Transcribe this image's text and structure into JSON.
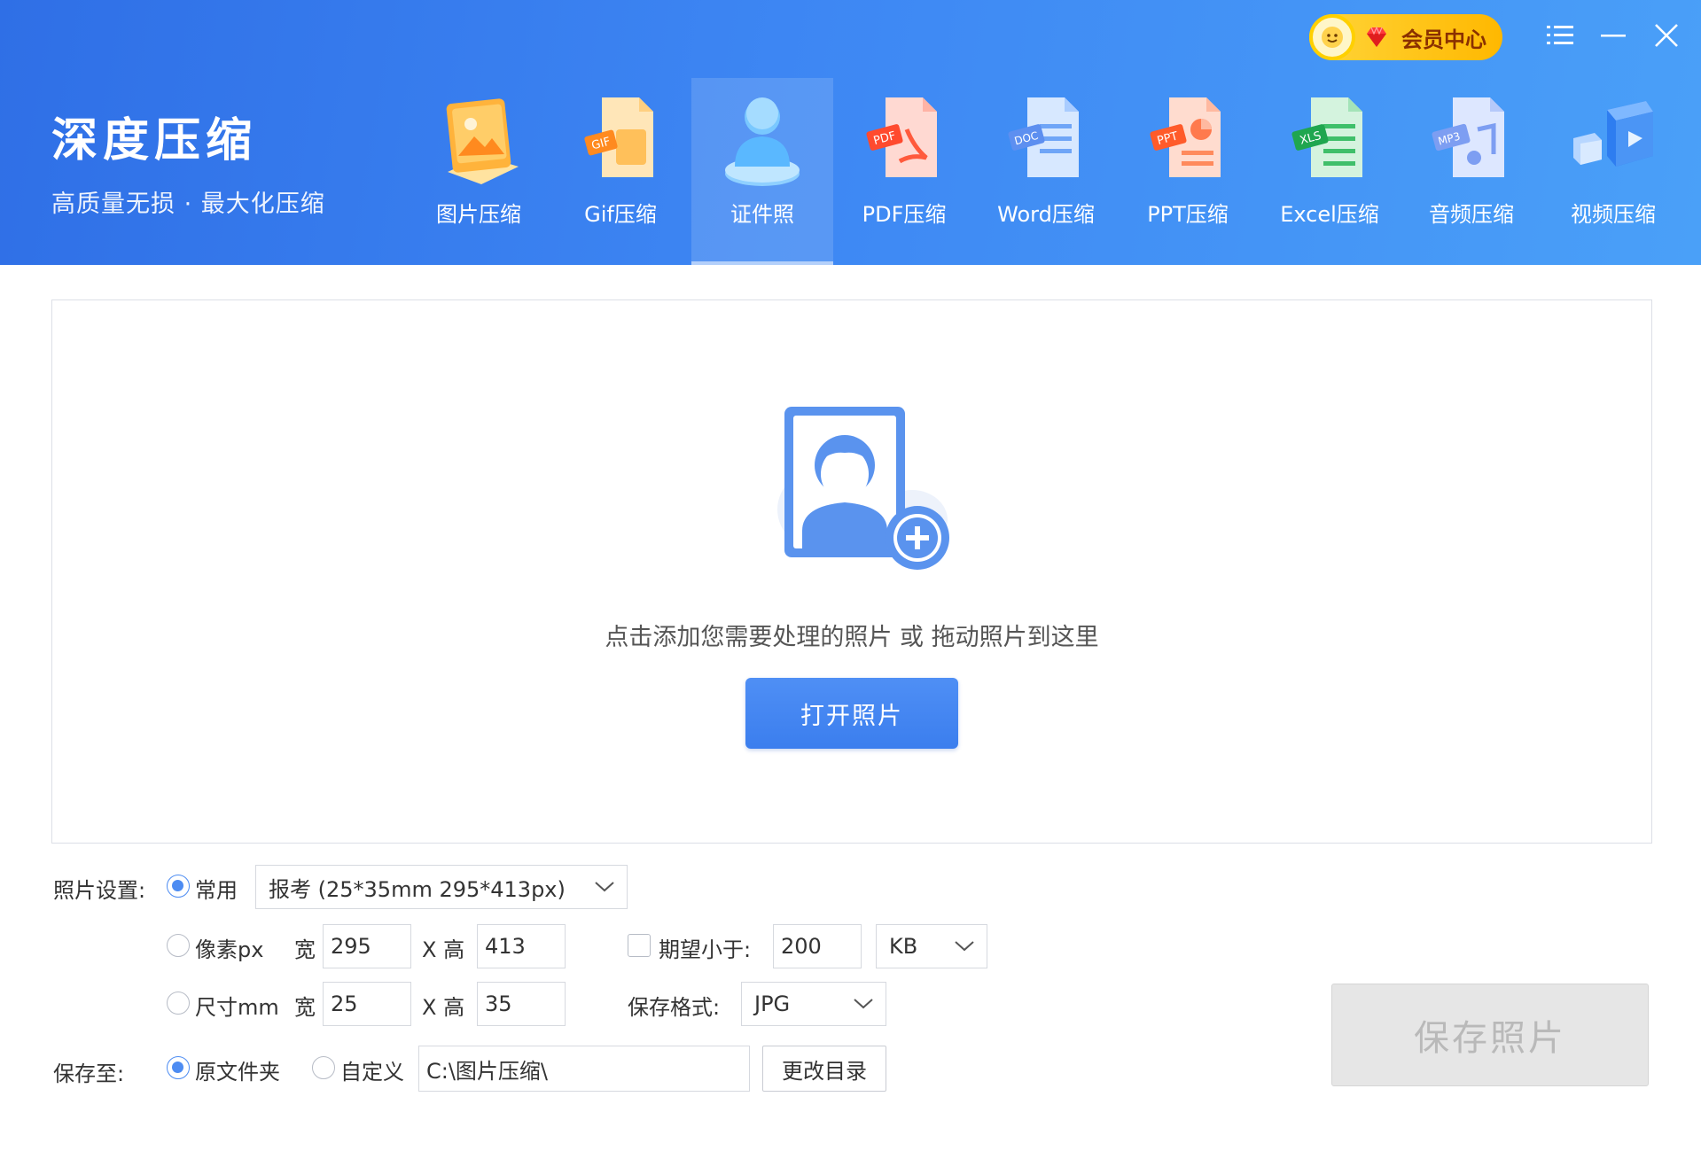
{
  "brand": {
    "title": "深度压缩",
    "subtitle": "高质量无损 · 最大化压缩"
  },
  "tools": [
    {
      "label": "图片压缩",
      "icon": "image-compress-icon"
    },
    {
      "label": "Gif压缩",
      "icon": "gif-compress-icon"
    },
    {
      "label": "证件照",
      "icon": "id-photo-icon",
      "active": true
    },
    {
      "label": "PDF压缩",
      "icon": "pdf-compress-icon"
    },
    {
      "label": "Word压缩",
      "icon": "word-compress-icon"
    },
    {
      "label": "PPT压缩",
      "icon": "ppt-compress-icon"
    },
    {
      "label": "Excel压缩",
      "icon": "excel-compress-icon"
    },
    {
      "label": "音频压缩",
      "icon": "audio-compress-icon"
    },
    {
      "label": "视频压缩",
      "icon": "video-compress-icon"
    }
  ],
  "vip": {
    "label": "会员中心"
  },
  "drop": {
    "hint": "点击添加您需要处理的照片 或 拖动照片到这里",
    "button": "打开照片"
  },
  "settings": {
    "photo_label": "照片设置:",
    "common": {
      "label": "常用",
      "selected": true,
      "preset": "报考 (25*35mm 295*413px)"
    },
    "pixel": {
      "label": "像素px",
      "width_label": "宽",
      "width": "295",
      "height_label": "X 高",
      "height": "413"
    },
    "size": {
      "label": "尺寸mm",
      "width_label": "宽",
      "width": "25",
      "height_label": "X 高",
      "height": "35"
    },
    "expect": {
      "label": "期望小于:",
      "checked": false,
      "value": "200",
      "unit": "KB"
    },
    "format": {
      "label": "保存格式:",
      "value": "JPG"
    },
    "save_to": {
      "label": "保存至:",
      "original": "原文件夹",
      "custom": "自定义",
      "path": "C:\\图片压缩\\",
      "change": "更改目录"
    },
    "save_button": "保存照片"
  },
  "colors": {
    "accent": "#3b7eee",
    "header_start": "#2f6fe6",
    "header_end": "#4aa0f8",
    "vip": "#ffc41a"
  }
}
